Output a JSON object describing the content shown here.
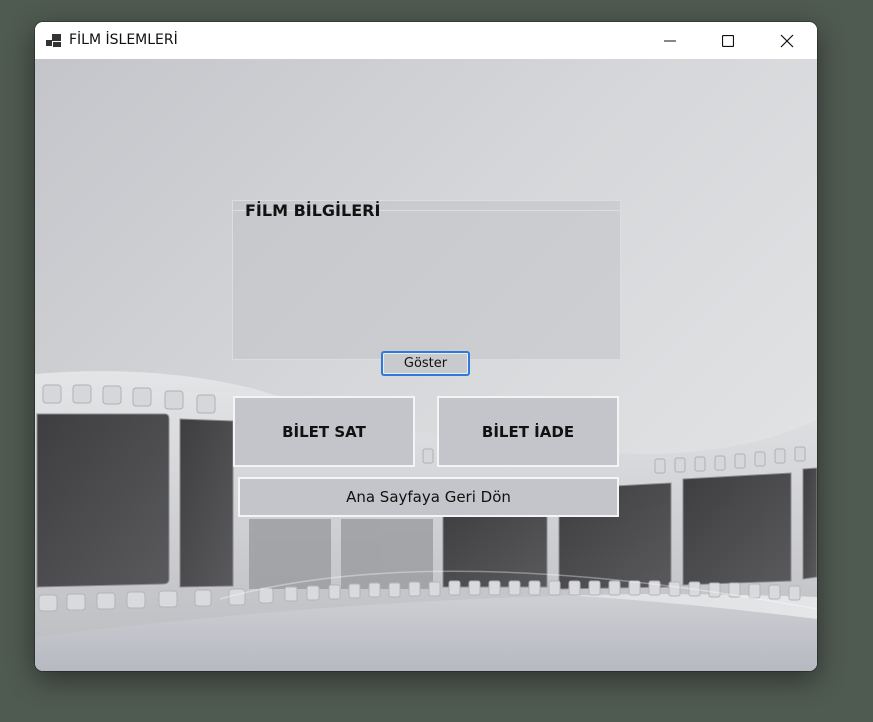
{
  "window": {
    "title": "FİLM İSLEMLERİ",
    "controls": {
      "minimize": "minimize-icon",
      "maximize": "maximize-icon",
      "close": "close-icon"
    }
  },
  "film_info": {
    "group_title": "FİLM BİLGİLERİ",
    "show_button": "Göster"
  },
  "actions": {
    "sell_ticket": "BİLET SAT",
    "refund_ticket": "BİLET İADE",
    "back_home": "Ana Sayfaya Geri Dön"
  },
  "colors": {
    "desktop": "#4f5a51",
    "focus_border": "#2f7ad8",
    "button_face": "#c4c5ca"
  }
}
